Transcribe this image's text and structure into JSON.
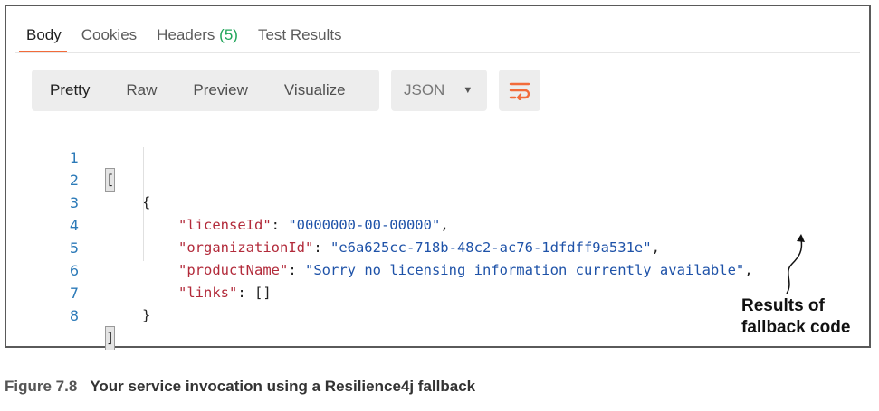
{
  "tabs": [
    {
      "label": "Body"
    },
    {
      "label": "Cookies"
    },
    {
      "label": "Headers",
      "count": "(5)"
    },
    {
      "label": "Test Results"
    }
  ],
  "format_buttons": [
    "Pretty",
    "Raw",
    "Preview",
    "Visualize"
  ],
  "language_select": {
    "value": "JSON"
  },
  "icons": {
    "wrap": "wrap-lines-icon",
    "caret": "chevron-down-icon"
  },
  "colors": {
    "accent": "#f26b3a",
    "count": "#20a55a",
    "key": "#b22a3a",
    "string": "#1e52a8",
    "line_number": "#2c7ab8"
  },
  "code_lines": [
    {
      "n": "1",
      "t": "["
    },
    {
      "n": "2",
      "t": "{"
    },
    {
      "n": "3",
      "k": "\"licenseId\"",
      "sep": ": ",
      "v": "\"0000000-00-00000\"",
      "end": ","
    },
    {
      "n": "4",
      "k": "\"organizationId\"",
      "sep": ": ",
      "v": "\"e6a625cc-718b-48c2-ac76-1dfdff9a531e\"",
      "end": ","
    },
    {
      "n": "5",
      "k": "\"productName\"",
      "sep": ": ",
      "v": "\"Sorry no licensing information currently available\"",
      "end": ","
    },
    {
      "n": "6",
      "k": "\"links\"",
      "sep": ": ",
      "v": "[]",
      "end": ""
    },
    {
      "n": "7",
      "t": "}"
    },
    {
      "n": "8",
      "t": "]"
    }
  ],
  "annotation": {
    "line1": "Results of",
    "line2": "fallback code"
  },
  "caption": {
    "number": "Figure 7.8",
    "text": "Your service invocation using a Resilience4j fallback"
  }
}
